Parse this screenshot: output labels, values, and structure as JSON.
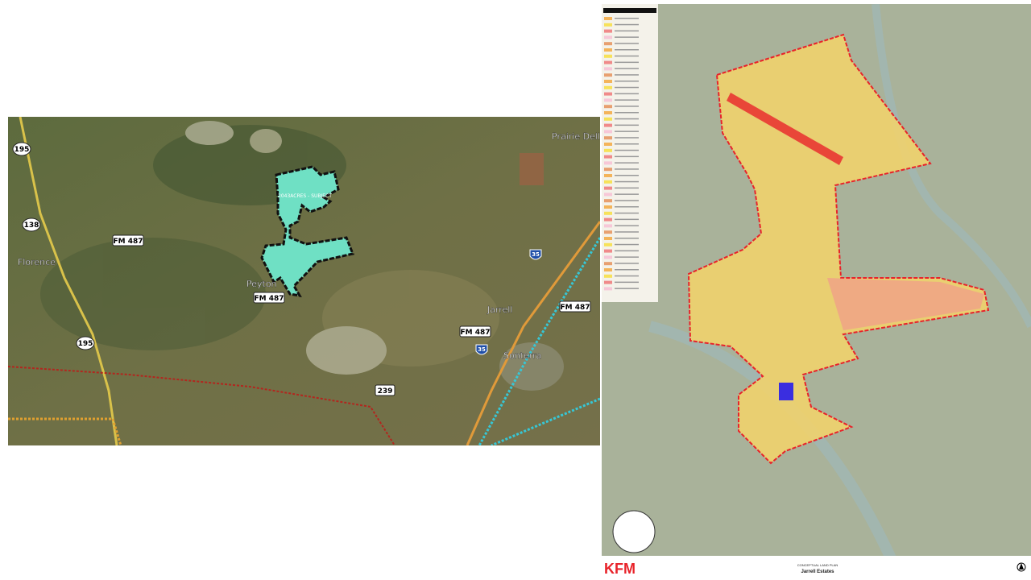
{
  "location_map": {
    "subject_label": "2043ACRES - SUBJECT",
    "subject_color": "#6fe0c4",
    "places": [
      {
        "name": "Florence"
      },
      {
        "name": "Peyton"
      },
      {
        "name": "Jarrell"
      },
      {
        "name": "Prairie Dell"
      },
      {
        "name": "Sonterra"
      }
    ],
    "road_shields": [
      "195",
      "138",
      "195",
      "FM 487",
      "FM 487",
      "FM 487",
      "FM 487",
      "239"
    ],
    "interstate_shields": [
      "35",
      "35"
    ]
  },
  "land_plan": {
    "plan_type": "CONCEPTUAL LAND PLAN",
    "project_name": "Jarrell Estates",
    "firm_logo": "KFM",
    "boundary_color": "#e8232a",
    "lot_colors": [
      "#f4b45a",
      "#f7e25a",
      "#f08a8a",
      "#f7c8d8",
      "#e8a070"
    ]
  }
}
